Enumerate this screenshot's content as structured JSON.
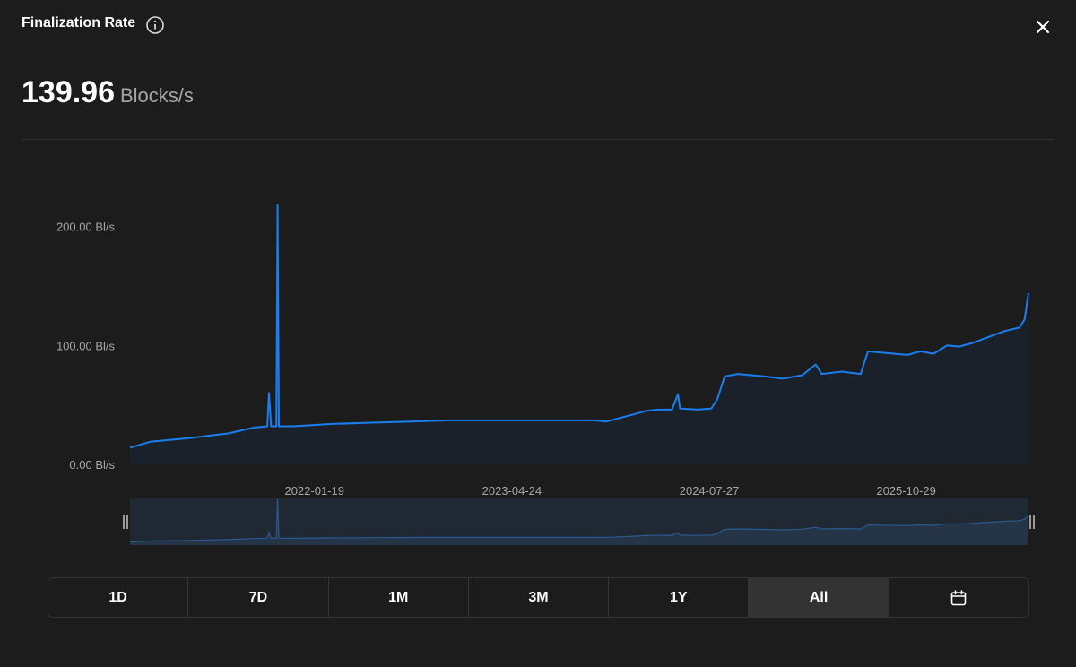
{
  "header": {
    "title": "Finalization Rate",
    "info_icon": "info-circle-icon",
    "close_icon": "close-x-icon"
  },
  "metric": {
    "value": "139.96",
    "unit": "Blocks/s"
  },
  "colors": {
    "background": "#1c1c1c",
    "line": "#1a7ef0",
    "area": "#1a212b",
    "text_muted": "#a6a6a6",
    "active_button": "#333333"
  },
  "chart_data": {
    "type": "area",
    "title": "",
    "xlabel": "",
    "ylabel": "",
    "x_start": "2020-11-15",
    "x_end": "2026-08-10",
    "ylim": [
      0,
      220
    ],
    "y_ticks": [
      {
        "value": 0,
        "label": "0.00 Bl/s"
      },
      {
        "value": 100,
        "label": "100.00 Bl/s"
      },
      {
        "value": 200,
        "label": "200.00 Bl/s"
      }
    ],
    "x_ticks": [
      {
        "date": "2022-01-19",
        "label": "2022-01-19"
      },
      {
        "date": "2023-04-24",
        "label": "2023-04-24"
      },
      {
        "date": "2024-07-27",
        "label": "2024-07-27"
      },
      {
        "date": "2025-10-29",
        "label": "2025-10-29"
      }
    ],
    "grid": false,
    "legend": "none",
    "series": [
      {
        "points": [
          [
            "2020-11-15",
            14
          ],
          [
            "2021-01-01",
            19
          ],
          [
            "2021-04-01",
            22
          ],
          [
            "2021-07-01",
            26
          ],
          [
            "2021-09-01",
            31
          ],
          [
            "2021-10-01",
            32
          ],
          [
            "2021-10-05",
            60
          ],
          [
            "2021-10-10",
            32
          ],
          [
            "2021-10-22",
            32
          ],
          [
            "2021-10-25",
            218
          ],
          [
            "2021-10-28",
            32
          ],
          [
            "2021-12-01",
            32
          ],
          [
            "2022-03-01",
            34
          ],
          [
            "2022-06-01",
            35
          ],
          [
            "2022-09-01",
            36
          ],
          [
            "2022-12-01",
            37
          ],
          [
            "2023-03-01",
            37
          ],
          [
            "2023-06-01",
            37
          ],
          [
            "2023-09-01",
            37
          ],
          [
            "2023-11-01",
            37
          ],
          [
            "2023-12-01",
            36
          ],
          [
            "2024-01-01",
            39
          ],
          [
            "2024-02-01",
            42
          ],
          [
            "2024-03-01",
            45
          ],
          [
            "2024-04-01",
            46
          ],
          [
            "2024-05-01",
            46
          ],
          [
            "2024-05-15",
            59
          ],
          [
            "2024-05-20",
            47
          ],
          [
            "2024-07-01",
            46
          ],
          [
            "2024-08-01",
            47
          ],
          [
            "2024-08-15",
            55
          ],
          [
            "2024-09-01",
            74
          ],
          [
            "2024-10-01",
            76
          ],
          [
            "2024-12-01",
            74
          ],
          [
            "2025-01-15",
            72
          ],
          [
            "2025-03-01",
            75
          ],
          [
            "2025-04-01",
            84
          ],
          [
            "2025-04-15",
            76
          ],
          [
            "2025-06-01",
            78
          ],
          [
            "2025-07-15",
            76
          ],
          [
            "2025-08-01",
            95
          ],
          [
            "2025-09-01",
            94
          ],
          [
            "2025-11-01",
            92
          ],
          [
            "2025-12-01",
            95
          ],
          [
            "2026-01-01",
            93
          ],
          [
            "2026-02-01",
            100
          ],
          [
            "2026-03-01",
            99
          ],
          [
            "2026-04-01",
            102
          ],
          [
            "2026-05-01",
            106
          ],
          [
            "2026-06-15",
            112
          ],
          [
            "2026-07-20",
            115
          ],
          [
            "2026-08-01",
            122
          ],
          [
            "2026-08-10",
            144
          ]
        ]
      }
    ]
  },
  "range_buttons": [
    {
      "label": "1D"
    },
    {
      "label": "7D"
    },
    {
      "label": "1M"
    },
    {
      "label": "3M"
    },
    {
      "label": "1Y"
    },
    {
      "label": "All",
      "active": true
    }
  ],
  "calendar_icon": "calendar-icon"
}
